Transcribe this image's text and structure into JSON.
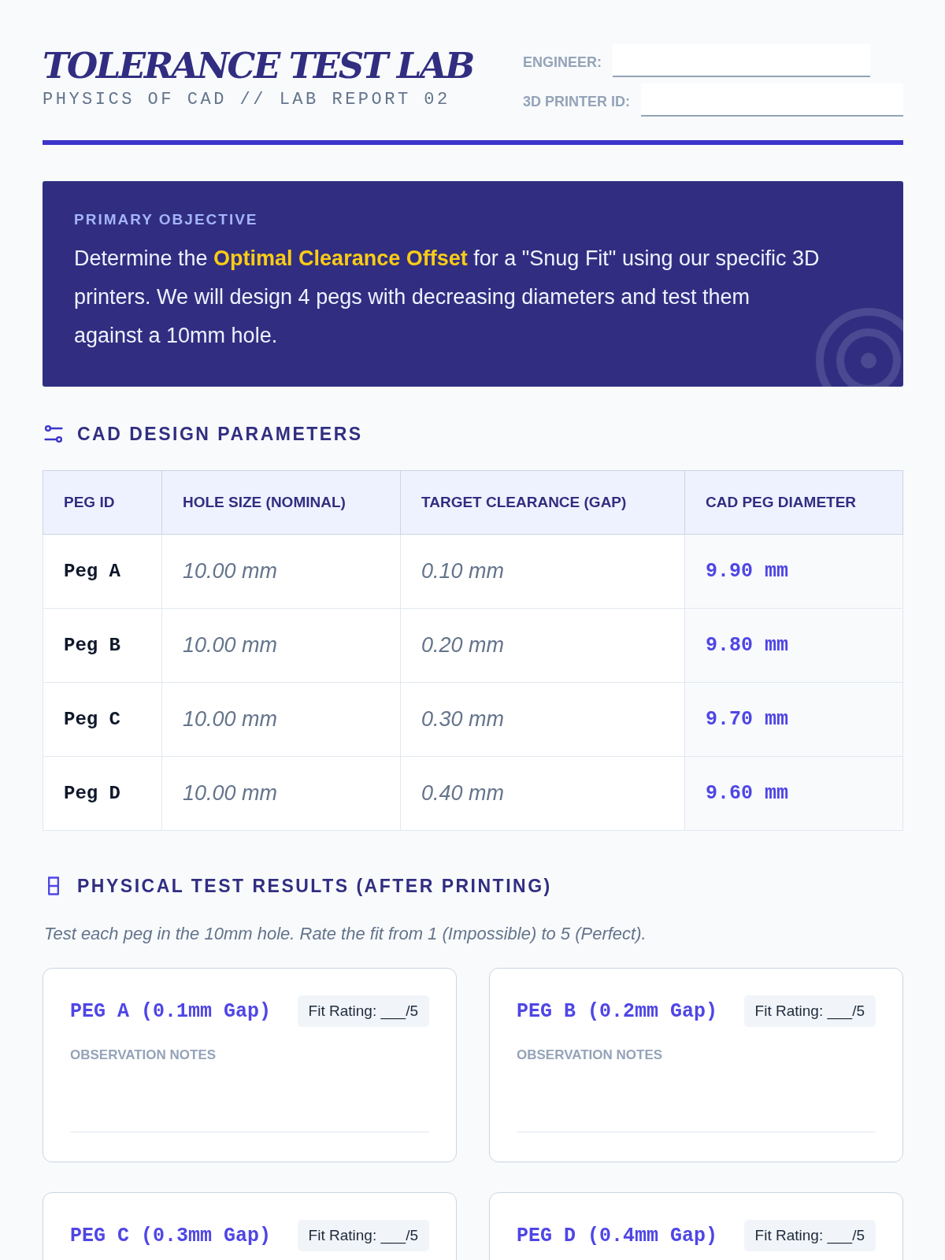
{
  "header": {
    "title": "TOLERANCE TEST LAB",
    "subtitle": "PHYSICS OF CAD // LAB REPORT 02",
    "fields": [
      {
        "label": "ENGINEER:"
      },
      {
        "label": "3D PRINTER ID:"
      }
    ]
  },
  "objective": {
    "label": "PRIMARY OBJECTIVE",
    "text": "Determine the **Optimal Clearance Offset** for a \"Snug Fit\" using our specific 3D printers. We will design 4 pegs with decreasing diameters and test them against a 10mm hole."
  },
  "design": {
    "heading": "CAD DESIGN PARAMETERS",
    "columns": [
      {
        "label": "PEG ID",
        "kind": "id"
      },
      {
        "label": "HOLE SIZE (NOMINAL)",
        "kind": "input"
      },
      {
        "label": "TARGET CLEARANCE (GAP)",
        "kind": "input"
      },
      {
        "label": "CAD PEG DIAMETER",
        "kind": "result"
      }
    ],
    "rows": [
      [
        "Peg A",
        "10.00 mm",
        "0.10 mm",
        "9.90 mm"
      ],
      [
        "Peg B",
        "10.00 mm",
        "0.20 mm",
        "9.80 mm"
      ],
      [
        "Peg C",
        "10.00 mm",
        "0.30 mm",
        "9.70 mm"
      ],
      [
        "Peg D",
        "10.00 mm",
        "0.40 mm",
        "9.60 mm"
      ]
    ]
  },
  "results": {
    "heading": "PHYSICAL TEST RESULTS (AFTER PRINTING)",
    "instructions": "Test each peg in the 10mm hole. Rate the fit from 1 (Impossible) to 5 (Perfect).",
    "cards": [
      {
        "title": "PEG A (0.1mm Gap)",
        "rating": "Fit Rating: ___/5",
        "notes_label": "OBSERVATION NOTES"
      },
      {
        "title": "PEG B (0.2mm Gap)",
        "rating": "Fit Rating: ___/5",
        "notes_label": "OBSERVATION NOTES"
      },
      {
        "title": "PEG C (0.3mm Gap)",
        "rating": "Fit Rating: ___/5"
      },
      {
        "title": "PEG D (0.4mm Gap)",
        "rating": "Fit Rating: ___/5"
      }
    ]
  }
}
